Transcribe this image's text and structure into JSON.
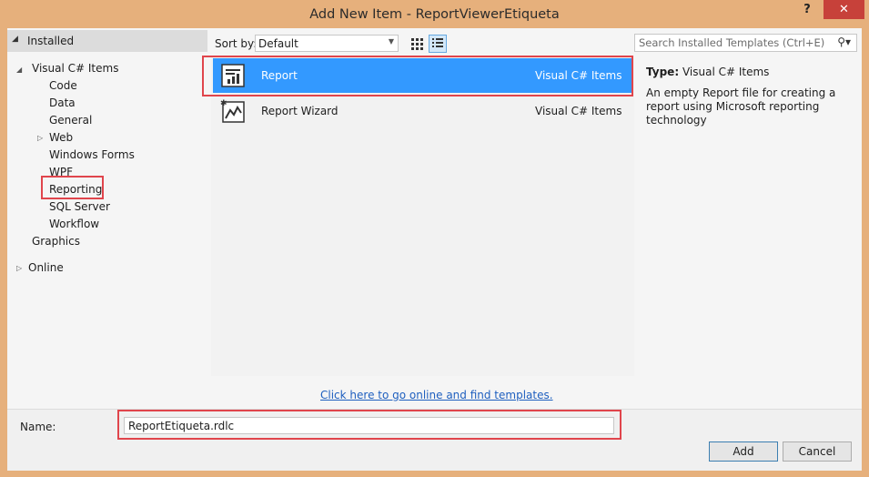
{
  "window": {
    "title": "Add New Item - ReportViewerEtiqueta",
    "help_label": "?",
    "close_label": "✕"
  },
  "tree": {
    "installed": "Installed",
    "visual_csharp": "Visual C# Items",
    "children": [
      "Code",
      "Data",
      "General",
      "Web",
      "Windows Forms",
      "WPF",
      "Reporting",
      "SQL Server",
      "Workflow"
    ],
    "graphics": "Graphics",
    "online": "Online",
    "selected": "Reporting"
  },
  "toolbar": {
    "sort_label": "Sort by:",
    "sort_value": "Default",
    "search_placeholder": "Search Installed Templates (Ctrl+E)"
  },
  "templates": [
    {
      "name": "Report",
      "category": "Visual C# Items",
      "icon": "report-icon",
      "selected": true
    },
    {
      "name": "Report Wizard",
      "category": "Visual C# Items",
      "icon": "report-wizard-icon",
      "selected": false
    }
  ],
  "details": {
    "type_label": "Type:",
    "type_value": "Visual C# Items",
    "description": "An empty Report file for creating a report using Microsoft reporting technology"
  },
  "online_link": "Click here to go online and find templates.",
  "bottom": {
    "name_label": "Name:",
    "name_value": "ReportEtiqueta.rdlc",
    "add_label": "Add",
    "cancel_label": "Cancel"
  },
  "colors": {
    "title_bar": "#e6b07c",
    "close_button": "#c7413a",
    "selection": "#3399ff",
    "highlight_box": "#e0454c",
    "link": "#1e5fbf"
  }
}
